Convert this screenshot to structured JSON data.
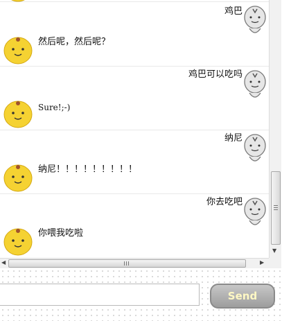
{
  "messages": [
    {
      "side": "right",
      "text": "鸡巴"
    },
    {
      "side": "left",
      "text": "然后呢，然后呢？"
    },
    {
      "side": "right",
      "text": "鸡巴可以吃吗"
    },
    {
      "side": "left",
      "text": "Sure!;-)"
    },
    {
      "side": "right",
      "text": "纳尼"
    },
    {
      "side": "left",
      "text": "纳尼！！！！！！！！！"
    },
    {
      "side": "right",
      "text": "你去吃吧"
    },
    {
      "side": "left",
      "text": "你喂我吃啦"
    }
  ],
  "composer": {
    "value": "",
    "placeholder": ""
  },
  "send_label": "Send",
  "colors": {
    "bot_avatar": "#f5d232",
    "user_avatar": "#d9d9d9",
    "send_text": "#fff8c4"
  }
}
